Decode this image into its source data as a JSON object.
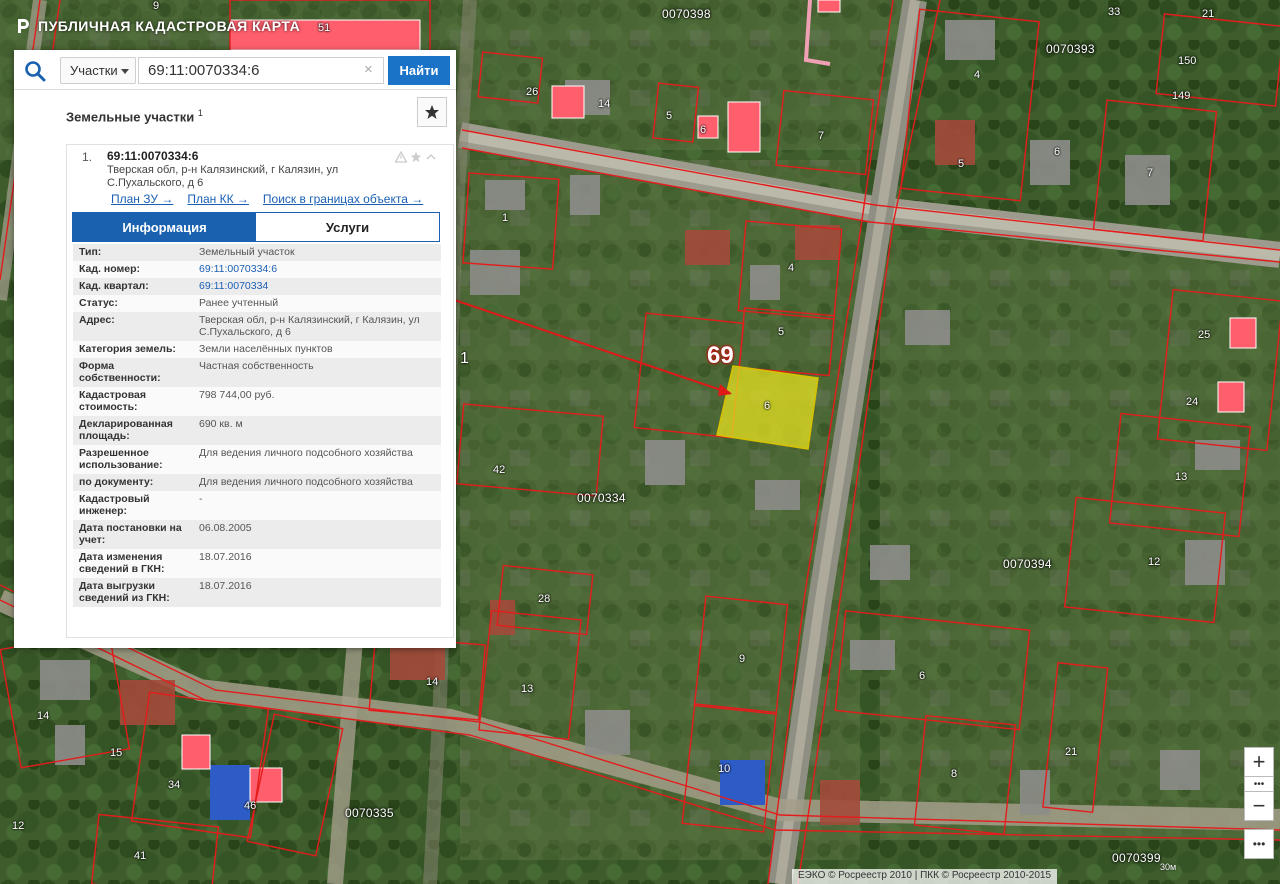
{
  "app": {
    "title": "ПУБЛИЧНАЯ КАДАСТРОВАЯ КАРТА"
  },
  "search": {
    "type_select": "Участки",
    "query": "69:11:0070334:6",
    "clear_icon": "×",
    "find_label": "Найти"
  },
  "results": {
    "title": "Земельные участки",
    "count": "1"
  },
  "card": {
    "number": "1.",
    "cad_number": "69:11:0070334:6",
    "address": "Тверская обл, р-н Калязинский, г Калязин, ул С.Пухальского, д 6",
    "links": {
      "plan_zu": "План ЗУ →",
      "plan_kk": "План КК →",
      "search_bounds": "Поиск в границах объекта →"
    },
    "tabs": {
      "info": "Информация",
      "services": "Услуги"
    },
    "rows": [
      {
        "key": "Тип:",
        "value": "Земельный участок",
        "link": false
      },
      {
        "key": "Кад. номер:",
        "value": "69:11:0070334:6",
        "link": true
      },
      {
        "key": "Кад. квартал:",
        "value": "69:11:0070334",
        "link": true
      },
      {
        "key": "Статус:",
        "value": "Ранее учтенный",
        "link": false
      },
      {
        "key": "Адрес:",
        "value": "Тверская обл, р-н Калязинский, г Калязин, ул С.Пухальского, д 6",
        "link": false
      },
      {
        "key": "Категория земель:",
        "value": "Земли населённых пунктов",
        "link": false
      },
      {
        "key": "Форма собственности:",
        "value": "Частная собственность",
        "link": false
      },
      {
        "key": "Кадастровая стоимость:",
        "value": "798 744,00 руб.",
        "link": false
      },
      {
        "key": "Декларированная площадь:",
        "value": "690 кв. м",
        "link": false
      },
      {
        "key": "Разрешенное использование:",
        "value": "Для ведения личного подсобного хозяйства",
        "link": false
      },
      {
        "key": "по документу:",
        "value": "Для ведения личного подсобного хозяйства",
        "link": false
      },
      {
        "key": "Кадастровый инженер:",
        "value": "-",
        "link": false
      },
      {
        "key": "Дата постановки на учет:",
        "value": "06.08.2005",
        "link": false
      },
      {
        "key": "Дата изменения сведений в ГКН:",
        "value": "18.07.2016",
        "link": false
      },
      {
        "key": "Дата выгрузки сведений из ГКН:",
        "value": "18.07.2016",
        "link": false
      }
    ]
  },
  "map": {
    "highlight_number": "69",
    "highlight_parcel": "6",
    "quarters": [
      "0070398",
      "0070393",
      "0070334",
      "0070394",
      "0070335",
      "0070399"
    ],
    "parcel_labels": [
      "51",
      "9",
      "33",
      "21",
      "150",
      "149",
      "26",
      "14",
      "5",
      "6",
      "7",
      "4",
      "5",
      "6",
      "7",
      "1",
      "4",
      "5",
      "25",
      "24",
      "42",
      "13",
      "12",
      "28",
      "9",
      "6",
      "14",
      "13",
      "10",
      "8",
      "21",
      "14",
      "15",
      "34",
      "46",
      "12",
      "41",
      "1"
    ],
    "zoom_in": "+",
    "zoom_out": "−",
    "more": "•••",
    "scale": "30м",
    "copyright": "ЕЭКО © Росреестр 2010 | ПКК © Росреестр 2010-2015"
  },
  "colors": {
    "accent": "#1a62b0",
    "highlight": "#e6e020",
    "boundary": "#e01818",
    "building": "#ff5a6a"
  },
  "icons": {
    "search": "search-icon",
    "star": "star-icon",
    "warning": "warning-icon",
    "collapse": "chevron-up-icon",
    "logo": "logo-icon"
  }
}
